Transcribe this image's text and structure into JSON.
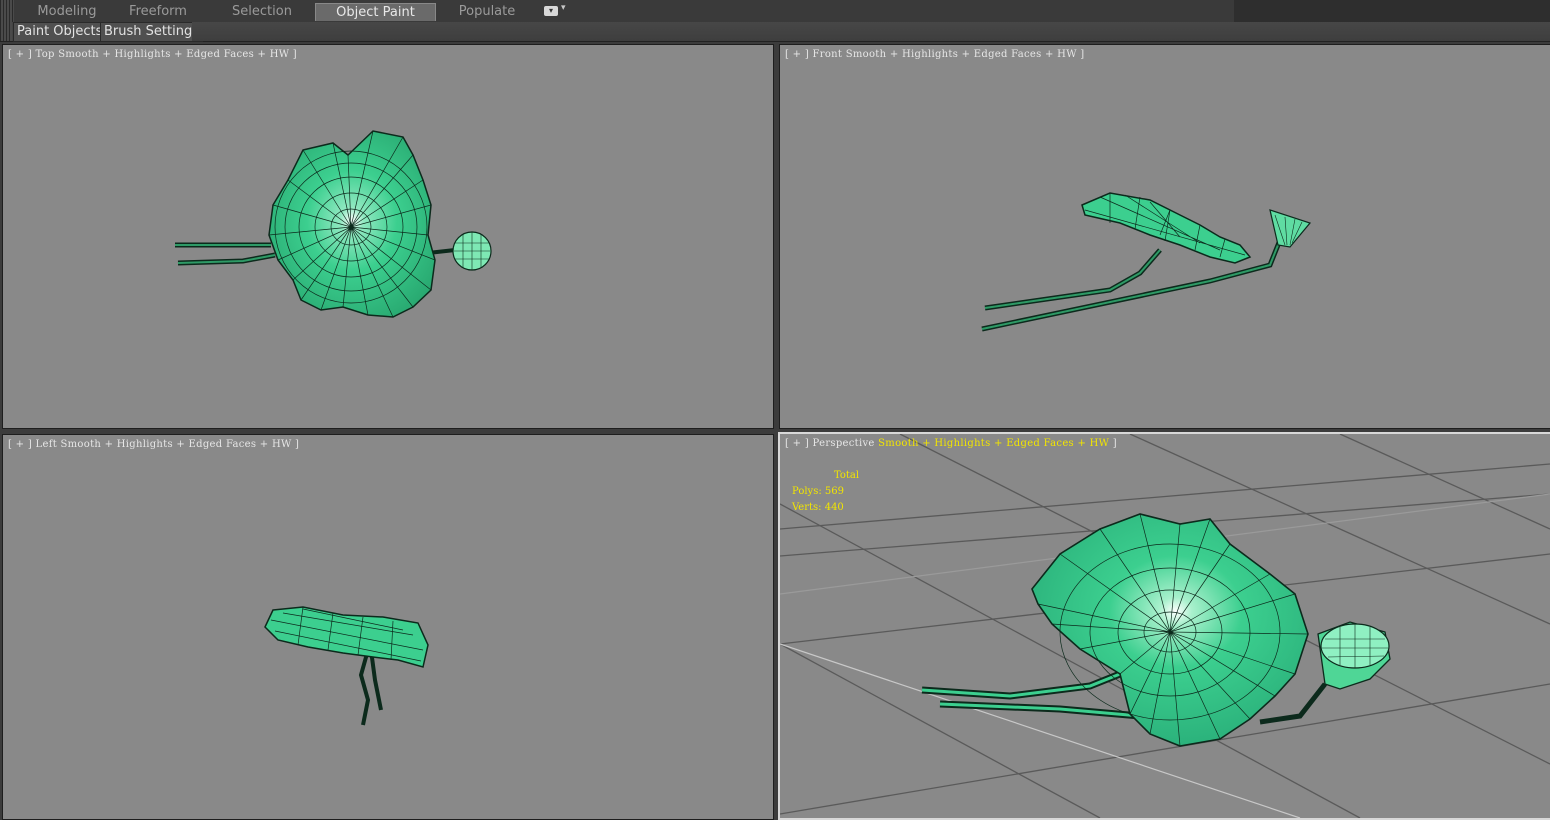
{
  "ribbon": {
    "tabs": [
      "Modeling",
      "Freeform",
      "Selection",
      "Object Paint",
      "Populate"
    ],
    "active_tab": "Object Paint"
  },
  "panels": {
    "paint_objects": "Paint Objects",
    "brush_settings": "Brush Settings"
  },
  "viewports": {
    "top": {
      "bracket_open": "[ + ]",
      "name": "Top",
      "mode": "Smooth + Highlights + Edged Faces + HW ]"
    },
    "front": {
      "bracket_open": "[ + ]",
      "name": "Front",
      "mode": "Smooth + Highlights + Edged Faces + HW ]"
    },
    "left": {
      "bracket_open": "[ + ]",
      "name": "Left",
      "mode": "Smooth + Highlights + Edged Faces + HW ]"
    },
    "perspective": {
      "bracket_open": "[ + ]",
      "name": "Perspective",
      "mode": "Smooth + Highlights + Edged Faces + HW",
      "bracket_close": "]",
      "stats": {
        "total": "Total",
        "polys": "Polys: 569",
        "verts": "Verts: 440"
      }
    }
  },
  "colors": {
    "viewport_bg": "#898989",
    "mesh_fill": "#36c88a",
    "mesh_edge": "#0c2a1c",
    "stats_text": "#f2e500"
  }
}
